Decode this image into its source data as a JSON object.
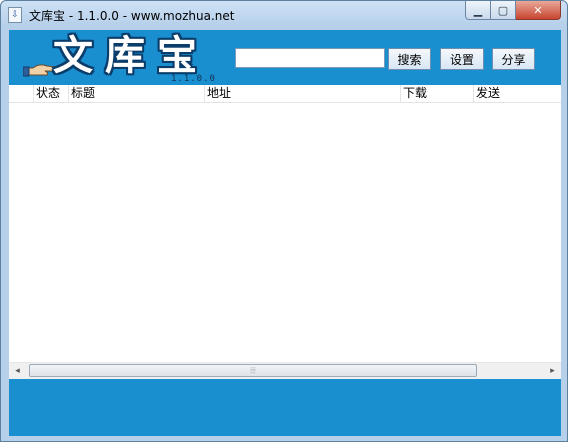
{
  "window": {
    "title": "文库宝 - 1.1.0.0 - www.mozhua.net",
    "icon": "document-download-icon",
    "controls": {
      "minimize": "minimize-icon",
      "maximize": "maximize-icon",
      "close": "close-icon"
    }
  },
  "logo": {
    "text": "文库宝",
    "version": "1.1.0.0"
  },
  "search": {
    "value": "",
    "placeholder": ""
  },
  "toolbar": {
    "search_label": "搜索",
    "settings_label": "设置",
    "share_label": "分享"
  },
  "table": {
    "columns": [
      "状态",
      "标题",
      "地址",
      "下载",
      "发送"
    ],
    "rows": []
  },
  "scrollbar": {
    "left_arrow": "◂",
    "right_arrow": "▸",
    "grip": "⦙⦙⦙"
  },
  "colors": {
    "accent": "#1a8fd0",
    "title_bar": "#bcd3ec"
  }
}
